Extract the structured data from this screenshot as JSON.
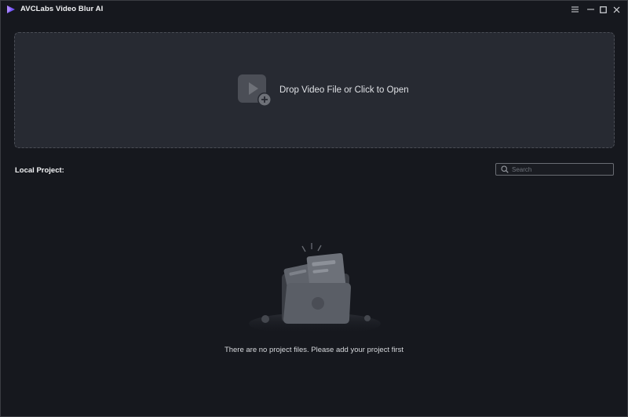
{
  "window": {
    "title": "AVCLabs Video Blur AI",
    "controls": [
      "menu",
      "minimize",
      "maximize",
      "close"
    ]
  },
  "dropzone": {
    "label": "Drop Video File or Click to Open",
    "icon": "video-add-icon"
  },
  "projects": {
    "label": "Local Project:",
    "search_placeholder": "Search",
    "search_value": "",
    "empty_message": "There are no project files. Please add your project first"
  },
  "colors": {
    "background": "#16181e",
    "dropzone_bg": "#272a32",
    "dropzone_border": "#4a4d55",
    "accent": "#7b5cf0"
  }
}
